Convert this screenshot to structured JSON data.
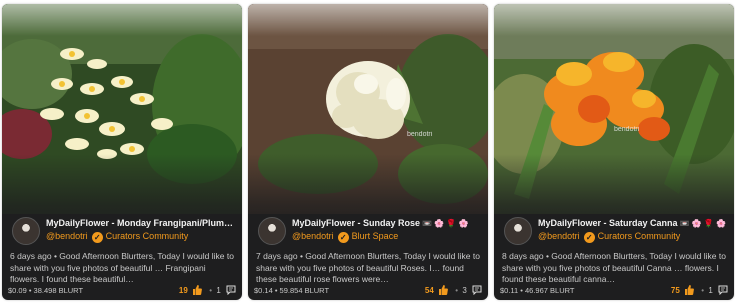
{
  "cards": [
    {
      "title": "MyDailyFlower - Monday Frangipani/Plume…",
      "emoji": "",
      "author": "@bendotri",
      "community": "Curators Community",
      "excerpt": "6 days ago • Good Afternoon Blurtters, Today I would like to share with you five photos of beautiful … Frangipani flowers. I found these beautiful…",
      "stats": "$0.09 • 38.498 BLURT",
      "votes": "19",
      "downvotes": "•",
      "comments": "1",
      "watermark": ""
    },
    {
      "title": "MyDailyFlower - Sunday Rose",
      "emoji": "📼 🌸 🌹 🌸",
      "author": "@bendotri",
      "community": "Blurt Space",
      "excerpt": "7 days ago • Good Afternoon Blurtters, Today I would like to share with you five photos of beautiful Roses. I… found these beautiful rose flowers were…",
      "stats": "$0.14 • 59.854 BLURT",
      "votes": "54",
      "downvotes": "•",
      "comments": "3",
      "watermark": "bendotri"
    },
    {
      "title": "MyDailyFlower - Saturday Canna",
      "emoji": "📼 🌸 🌹 🌸",
      "author": "@bendotri",
      "community": "Curators Community",
      "excerpt": "8 days ago • Good Afternoon Blurtters, Today I would like to share with you five photos of beautiful Canna … flowers. I found these beautiful canna…",
      "stats": "$0.11 • 46.967 BLURT",
      "votes": "75",
      "downvotes": "•",
      "comments": "1",
      "watermark": "bendotri"
    }
  ],
  "icons": {
    "verified": "check-badge-icon",
    "upvote": "thumbs-up-icon",
    "comments": "comment-icon"
  },
  "colors": {
    "accent": "#f29a1d",
    "card_bg": "#1e1e1f",
    "text": "#c9c9c9"
  }
}
